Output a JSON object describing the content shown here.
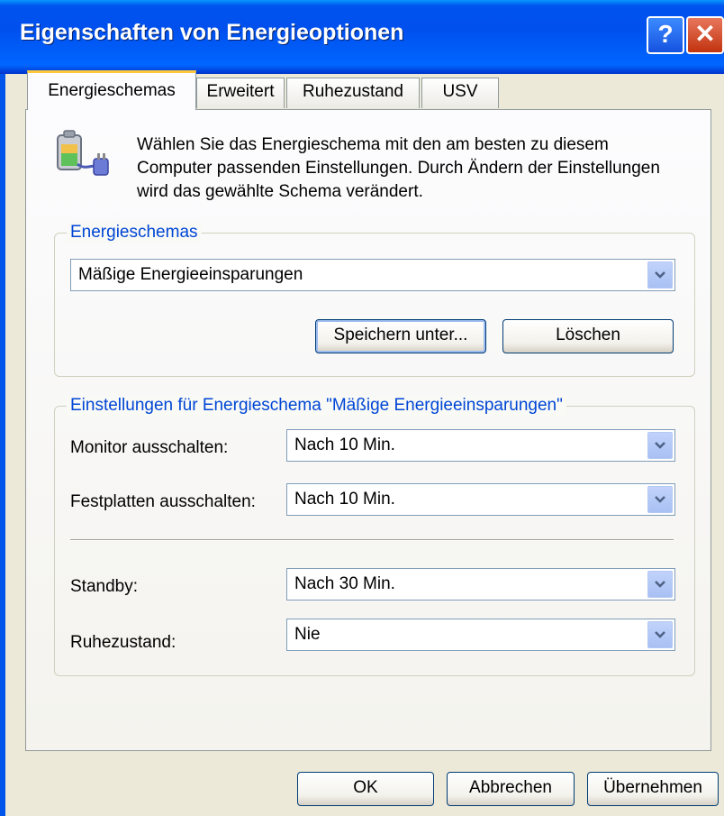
{
  "window": {
    "title": "Eigenschaften von Energieoptionen",
    "help_glyph": "?",
    "close_glyph": "✕"
  },
  "tabs": [
    {
      "label": "Energieschemas",
      "active": true
    },
    {
      "label": "Erweitert",
      "active": false
    },
    {
      "label": "Ruhezustand",
      "active": false
    },
    {
      "label": "USV",
      "active": false
    }
  ],
  "intro": {
    "icon": "power-battery-plug-icon",
    "text": "Wählen Sie das Energieschema mit den am besten zu diesem Computer passenden Einstellungen. Durch Ändern der Einstellungen wird das gewählte Schema verändert."
  },
  "schemes": {
    "legend": "Energieschemas",
    "selected": "Mäßige Energieeinsparungen",
    "save_as": "Speichern unter...",
    "delete": "Löschen"
  },
  "settings": {
    "legend": "Einstellungen für Energieschema \"Mäßige Energieeinsparungen\"",
    "monitor_label": "Monitor ausschalten:",
    "monitor_value": "Nach 10 Min.",
    "disks_label": "Festplatten ausschalten:",
    "disks_value": "Nach 10 Min.",
    "standby_label": "Standby:",
    "standby_value": "Nach 30 Min.",
    "hibernate_label": "Ruhezustand:",
    "hibernate_value": "Nie"
  },
  "buttons": {
    "ok": "OK",
    "cancel": "Abbrechen",
    "apply": "Übernehmen"
  },
  "colors": {
    "titlebar": "#0054e3",
    "legend_text": "#0046d5",
    "dialog_bg": "#ece9d8",
    "tab_highlight": "#ffc83c"
  }
}
